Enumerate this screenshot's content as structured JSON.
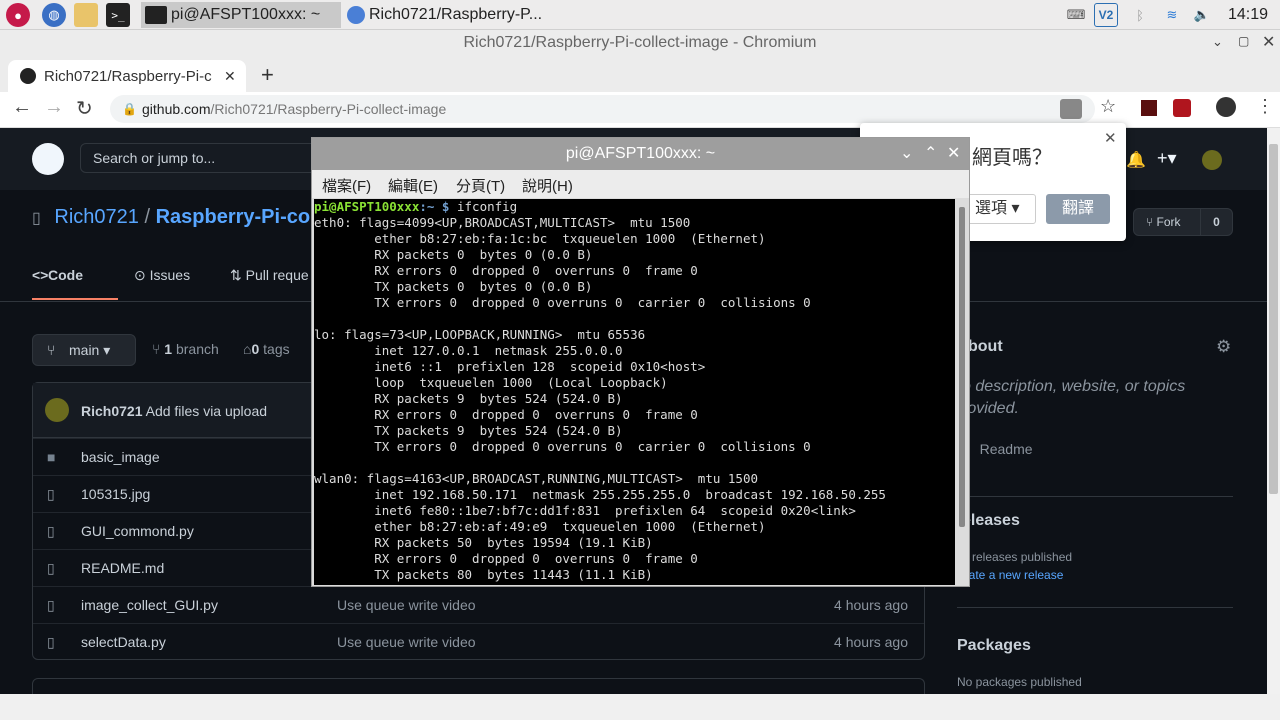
{
  "taskbar": {
    "tasks": [
      {
        "label": "pi@AFSPT100xxx: ~"
      },
      {
        "label": "Rich0721/Raspberry-P..."
      }
    ],
    "clock": "14:19"
  },
  "browser": {
    "window_title": "Rich0721/Raspberry-Pi-collect-image - Chromium",
    "tab_label": "Rich0721/Raspberry-Pi-c",
    "url_host": "github.com",
    "url_path": "/Rich0721/Raspberry-Pi-collect-image"
  },
  "github": {
    "search_placeholder": "Search or jump to...",
    "owner": "Rich0721",
    "separator": "/",
    "repo": "Raspberry-Pi-collect",
    "fork_label": "Fork",
    "fork_count": "0",
    "tabs": [
      {
        "label": "Code"
      },
      {
        "label": "Issues"
      },
      {
        "label": "Pull reque"
      }
    ],
    "branch": "main",
    "branch_count": "1",
    "branch_word": "branch",
    "tag_count": "0",
    "tag_word": "tags",
    "commit_author": "Rich0721",
    "commit_message": "Add files via upload",
    "files": [
      {
        "name": "basic_image",
        "type": "dir",
        "message": "",
        "time": ""
      },
      {
        "name": "105315.jpg",
        "type": "file",
        "message": "",
        "time": ""
      },
      {
        "name": "GUI_commond.py",
        "type": "file",
        "message": "",
        "time": ""
      },
      {
        "name": "README.md",
        "type": "file",
        "message": "",
        "time": ""
      },
      {
        "name": "image_collect_GUI.py",
        "type": "file",
        "message": "Use queue write video",
        "time": "4 hours ago"
      },
      {
        "name": "selectData.py",
        "type": "file",
        "message": "Use queue write video",
        "time": "4 hours ago"
      }
    ],
    "about_heading": "bout",
    "about_text_1": "o description, website, or topics",
    "about_text_2": "rovided.",
    "readme_label": "Readme",
    "releases_heading": "eleases",
    "releases_text": "o releases published",
    "releases_link": "eate a new release",
    "packages_heading": "Packages",
    "packages_text": "No packages published"
  },
  "translate_popup": {
    "question": "網頁嗎？",
    "options_label": "選項",
    "translate_button": "翻譯"
  },
  "terminal": {
    "title": "pi@AFSPT100xxx: ~",
    "menu": [
      "檔案(F)",
      "編輯(E)",
      "分頁(T)",
      "說明(H)"
    ],
    "prompt_user": "pi@AFSPT100xxx",
    "prompt_path": ":~ $",
    "command": " ifconfig",
    "output": [
      "eth0: flags=4099<UP,BROADCAST,MULTICAST>  mtu 1500",
      "        ether b8:27:eb:fa:1c:bc  txqueuelen 1000  (Ethernet)",
      "        RX packets 0  bytes 0 (0.0 B)",
      "        RX errors 0  dropped 0  overruns 0  frame 0",
      "        TX packets 0  bytes 0 (0.0 B)",
      "        TX errors 0  dropped 0 overruns 0  carrier 0  collisions 0",
      "",
      "lo: flags=73<UP,LOOPBACK,RUNNING>  mtu 65536",
      "        inet 127.0.0.1  netmask 255.0.0.0",
      "        inet6 ::1  prefixlen 128  scopeid 0x10<host>",
      "        loop  txqueuelen 1000  (Local Loopback)",
      "        RX packets 9  bytes 524 (524.0 B)",
      "        RX errors 0  dropped 0  overruns 0  frame 0",
      "        TX packets 9  bytes 524 (524.0 B)",
      "        TX errors 0  dropped 0 overruns 0  carrier 0  collisions 0",
      "",
      "wlan0: flags=4163<UP,BROADCAST,RUNNING,MULTICAST>  mtu 1500",
      "        inet 192.168.50.171  netmask 255.255.255.0  broadcast 192.168.50.255",
      "        inet6 fe80::1be7:bf7c:dd1f:831  prefixlen 64  scopeid 0x20<link>",
      "        ether b8:27:eb:af:49:e9  txqueuelen 1000  (Ethernet)",
      "        RX packets 50  bytes 19594 (19.1 KiB)",
      "        RX errors 0  dropped 0  overruns 0  frame 0",
      "        TX packets 80  bytes 11443 (11.1 KiB)"
    ]
  }
}
